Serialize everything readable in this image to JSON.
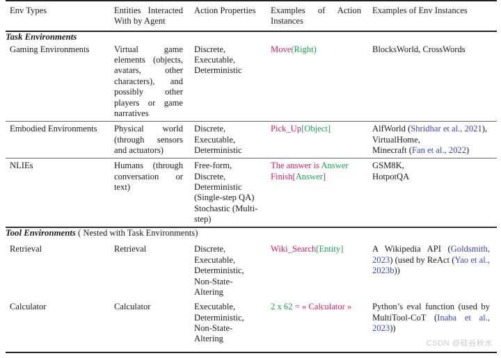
{
  "table": {
    "headers": [
      "Env Types",
      "Entities Interacted With by Agent",
      "Action Properties",
      "Examples of Action Instances",
      "Examples of Env Instances"
    ],
    "sections": [
      {
        "id": "task-environments",
        "title": "Task Environments",
        "note": "",
        "rows": [
          {
            "env_type": "Gaming Environments",
            "entities": "Virtual game elements (objects, avatars, other characters), and possibly other players or game narratives",
            "action_properties": "Discrete, Executable, Deterministic",
            "action_examples": [
              [
                {
                  "t": "Move",
                  "c": "act"
                },
                {
                  "t": "(",
                  "c": "arg"
                },
                {
                  "t": "Right",
                  "c": "arg"
                },
                {
                  "t": ")",
                  "c": "arg"
                }
              ]
            ],
            "env_instances": [
              [
                {
                  "t": "BlocksWorld, CrossWords",
                  "c": "plain"
                }
              ]
            ]
          },
          {
            "env_type": "Embodied Environments",
            "entities": "Physical world (through sensors and actuators)",
            "action_properties": "Discrete, Executable, Deterministic",
            "action_examples": [
              [
                {
                  "t": "Pick_Up",
                  "c": "act"
                },
                {
                  "t": "[Object]",
                  "c": "arg"
                }
              ]
            ],
            "env_instances": [
              [
                {
                  "t": "AlfWorld (",
                  "c": "plain"
                },
                {
                  "t": "Shridhar et al., 2021",
                  "c": "cite"
                },
                {
                  "t": "),",
                  "c": "plain"
                }
              ],
              [
                {
                  "t": "VirtualHome,",
                  "c": "plain"
                }
              ],
              [
                {
                  "t": "Minecraft (",
                  "c": "plain"
                },
                {
                  "t": "Fan et al., 2022",
                  "c": "cite"
                },
                {
                  "t": ")",
                  "c": "plain"
                }
              ]
            ]
          },
          {
            "env_type": "NLIEs",
            "entities": "Humans (through conversation or text)",
            "action_properties": "Free-form, Discrete, Deterministic (Single-step QA) Stochastic (Multi-step)",
            "action_examples": [
              [
                {
                  "t": "The answer is ",
                  "c": "act"
                },
                {
                  "t": "Answer",
                  "c": "arg"
                }
              ],
              [
                {
                  "t": "Finish",
                  "c": "act"
                },
                {
                  "t": "[",
                  "c": "act"
                },
                {
                  "t": "Answer",
                  "c": "arg"
                },
                {
                  "t": "]",
                  "c": "act"
                }
              ]
            ],
            "env_instances": [
              [
                {
                  "t": "GSM8K,",
                  "c": "plain"
                }
              ],
              [
                {
                  "t": "HotpotQA",
                  "c": "plain"
                }
              ]
            ]
          }
        ]
      },
      {
        "id": "tool-environments",
        "title": "Tool Environments",
        "note": " ( Nested with Task Environments)",
        "rows": [
          {
            "env_type": "Retrieval",
            "entities": "Retrieval",
            "action_properties": "Discrete, Executable, Deterministic, Non-State-Altering",
            "action_examples": [
              [
                {
                  "t": "Wiki_Search",
                  "c": "act"
                },
                {
                  "t": "[Entity]",
                  "c": "arg"
                }
              ]
            ],
            "env_instances": [
              [
                {
                  "t": "A Wikipedia API (",
                  "c": "plain"
                },
                {
                  "t": "Goldsmith, 2023",
                  "c": "cite"
                },
                {
                  "t": ") (used by ReAct (",
                  "c": "plain"
                },
                {
                  "t": "Yao et al., 2023b",
                  "c": "cite"
                },
                {
                  "t": "))",
                  "c": "plain"
                }
              ]
            ]
          },
          {
            "env_type": "Calculator",
            "entities": "Calculator",
            "action_properties": "Executable, Deterministic, Non-State-Altering",
            "action_examples": [
              [
                {
                  "t": "2 x 62 ",
                  "c": "arg"
                },
                {
                  "t": "= « Calculator »",
                  "c": "act"
                }
              ]
            ],
            "env_instances": [
              [
                {
                  "t": "Python’s eval function (used by MultiTool-CoT (",
                  "c": "plain"
                },
                {
                  "t": "Inaba et al., 2023",
                  "c": "cite"
                },
                {
                  "t": "))",
                  "c": "plain"
                }
              ]
            ]
          }
        ]
      }
    ]
  },
  "watermark": "CSDN @硅谷秋水"
}
